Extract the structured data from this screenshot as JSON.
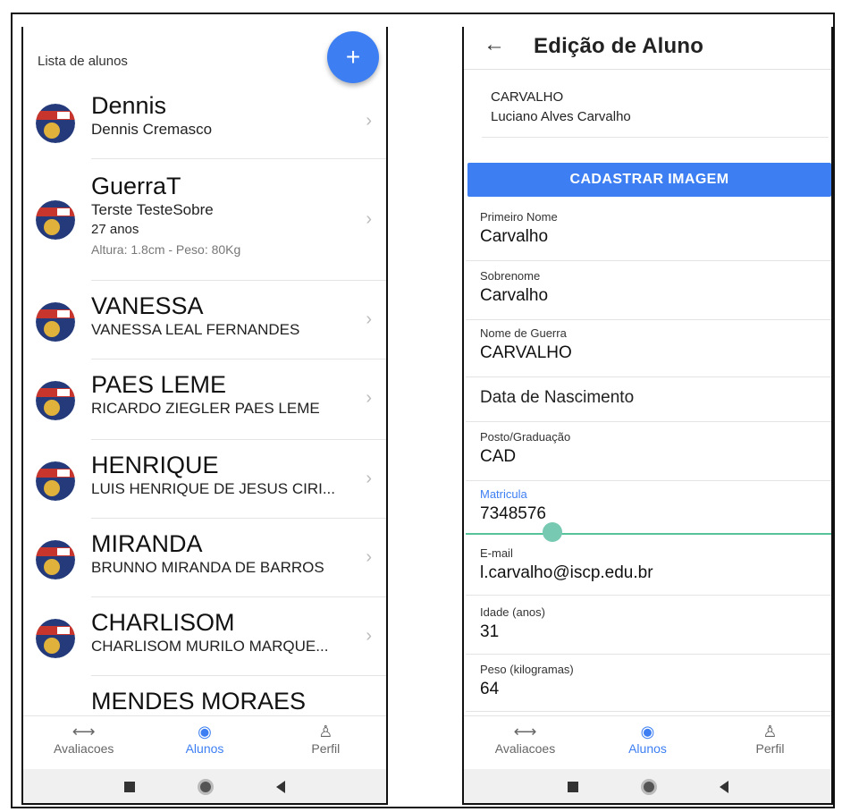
{
  "left": {
    "header": "Lista de alunos",
    "fab_label": "+",
    "students": [
      {
        "nick": "Dennis",
        "full": "Dennis Cremasco"
      },
      {
        "nick": "GuerraT",
        "full": "Terste TesteSobre",
        "age": "27 anos",
        "meta": "Altura: 1.8cm - Peso: 80Kg"
      },
      {
        "nick": "VANESSA",
        "full": "VANESSA LEAL FERNANDES"
      },
      {
        "nick": "PAES LEME",
        "full": "RICARDO ZIEGLER PAES LEME"
      },
      {
        "nick": "HENRIQUE",
        "full": "LUIS HENRIQUE DE JESUS CIRI..."
      },
      {
        "nick": "MIRANDA",
        "full": "BRUNNO MIRANDA DE BARROS"
      },
      {
        "nick": "CHARLISOM",
        "full": "CHARLISOM MURILO MARQUE..."
      },
      {
        "nick": "MENDES MORAES",
        "full": ""
      }
    ],
    "chevron": "›"
  },
  "right": {
    "title": "Edição de Aluno",
    "back_icon": "←",
    "card_line1": "CARVALHO",
    "card_line2": "Luciano Alves Carvalho",
    "button_label": "CADASTRAR IMAGEM",
    "fields": [
      {
        "label": "Primeiro Nome",
        "value": "Carvalho"
      },
      {
        "label": "Sobrenome",
        "value": "Carvalho"
      },
      {
        "label": "Nome de Guerra",
        "value": "CARVALHO"
      },
      {
        "label": "",
        "value": "Data de Nascimento"
      },
      {
        "label": "Posto/Graduação",
        "value": "CAD"
      },
      {
        "label": "Matricula",
        "value": "7348576"
      },
      {
        "label": "E-mail",
        "value": "l.carvalho@iscp.edu.br"
      },
      {
        "label": "Idade (anos)",
        "value": "31"
      },
      {
        "label": "Peso (kilogramas)",
        "value": "64"
      }
    ]
  },
  "nav": {
    "items": [
      {
        "label": "Avaliacoes",
        "icon": "ruler-icon"
      },
      {
        "label": "Alunos",
        "icon": "user-circle-icon"
      },
      {
        "label": "Perfil",
        "icon": "person-icon"
      }
    ],
    "active": "Alunos"
  },
  "colors": {
    "accent": "#3d7ff2",
    "focus_line": "#56c39a"
  }
}
